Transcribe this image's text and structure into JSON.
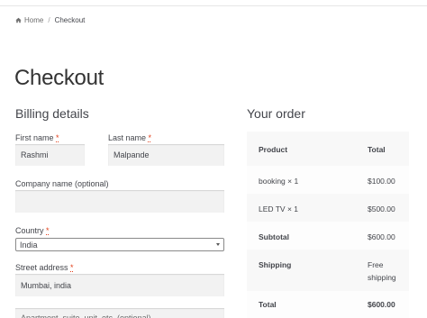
{
  "breadcrumb": {
    "home_label": "Home",
    "separator": "/",
    "current_label": "Checkout"
  },
  "page": {
    "title": "Checkout"
  },
  "billing": {
    "heading": "Billing details",
    "first_name": {
      "label": "First name",
      "required_mark": "*",
      "value": "Rashmi"
    },
    "last_name": {
      "label": "Last name",
      "required_mark": "*",
      "value": "Malpande"
    },
    "company": {
      "label": "Company name (optional)",
      "value": ""
    },
    "country": {
      "label": "Country",
      "required_mark": "*",
      "value": "India"
    },
    "street": {
      "label": "Street address",
      "required_mark": "*",
      "value": "Mumbai, india",
      "next_placeholder": "Apartment, suite, unit, etc. (optional)"
    }
  },
  "order": {
    "heading": "Your order",
    "header": {
      "product": "Product",
      "total": "Total"
    },
    "items": [
      {
        "product": "booking",
        "qty": "× 1",
        "total": "$100.00"
      },
      {
        "product": "LED TV",
        "qty": "× 1",
        "total": "$500.00"
      }
    ],
    "subtotal": {
      "label": "Subtotal",
      "value": "$600.00"
    },
    "shipping": {
      "label": "Shipping",
      "value_line1": "Free",
      "value_line2": "shipping"
    },
    "total": {
      "label": "Total",
      "value": "$600.00"
    }
  },
  "colors": {
    "required": "#e2401c",
    "input_bg": "#f2f2f2",
    "table_shade": "#f8f8f8"
  }
}
